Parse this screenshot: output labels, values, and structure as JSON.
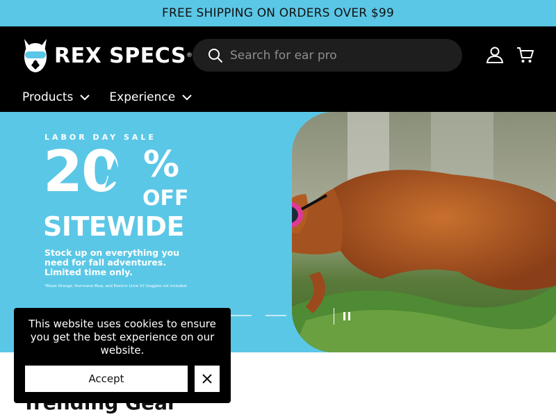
{
  "announcement": {
    "text": "FREE SHIPPING ON ORDERS OVER $99"
  },
  "header": {
    "logo_text": "REX SPECS",
    "logo_reg": "®",
    "search": {
      "placeholder": "Search for ear pro",
      "value": ""
    },
    "icons": {
      "account": "user-icon",
      "cart": "cart-icon",
      "search": "search-icon"
    }
  },
  "nav": {
    "items": [
      {
        "label": "Products"
      },
      {
        "label": "Experience"
      }
    ]
  },
  "hero": {
    "eyebrow": "LABOR DAY SALE",
    "big_number": "20",
    "percent": "%",
    "off": "OFF",
    "headline": "SITEWIDE",
    "body": "Stock up on everything you need for fall adventures. Limited time only.",
    "fine_print": "*Blaze Orange, Hurricane Blue, and Electric Lime V2 Goggles not included.",
    "colors": {
      "background": "#5bc7e6",
      "text": "#ffffff"
    }
  },
  "cookie_banner": {
    "message": "This website uses cookies to ensure you get the best experience on our website.",
    "accept_label": "Accept"
  },
  "section": {
    "title": "Trending Gear"
  }
}
